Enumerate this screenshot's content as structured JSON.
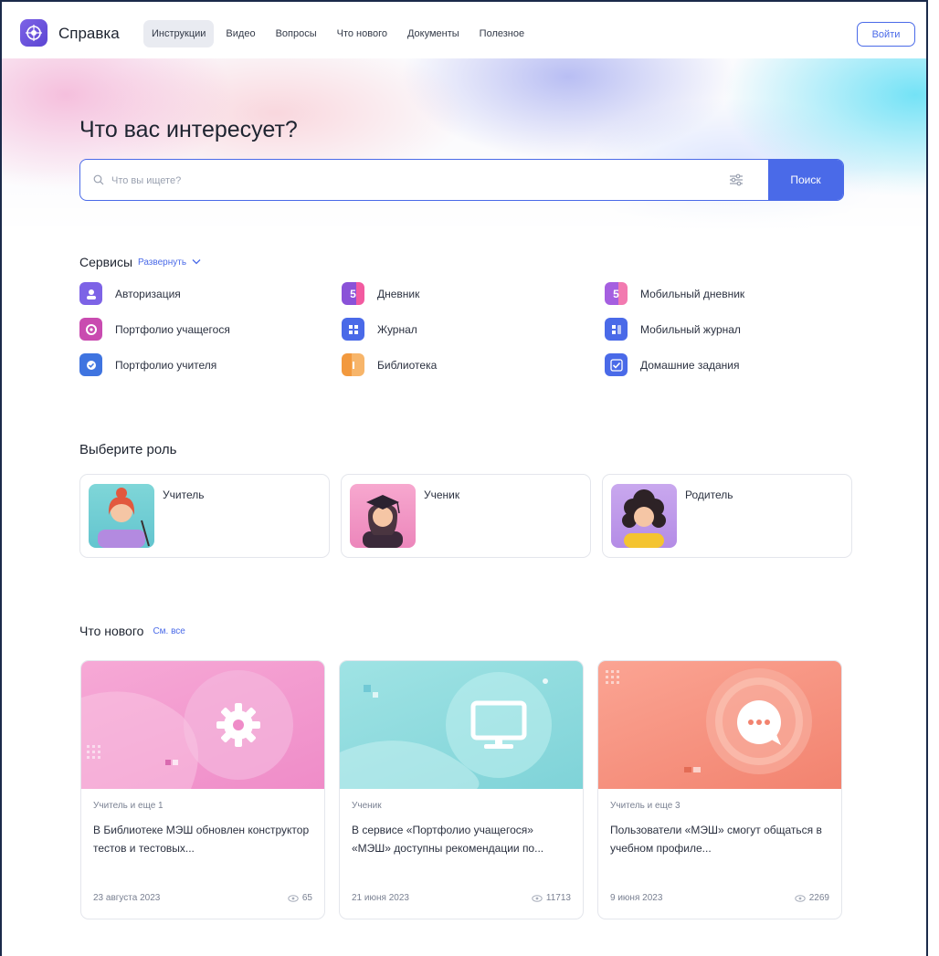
{
  "header": {
    "title": "Справка",
    "nav": [
      "Инструкции",
      "Видео",
      "Вопросы",
      "Что нового",
      "Документы",
      "Полезное"
    ],
    "active_nav": "Инструкции",
    "login_label": "Войти"
  },
  "hero": {
    "title": "Что вас интересует?",
    "search_placeholder": "Что вы ищете?",
    "search_value": "",
    "search_button": "Поиск"
  },
  "services": {
    "title": "Сервисы",
    "expand_label": "Развернуть",
    "items": [
      {
        "label": "Авторизация",
        "icon": "user-lock-icon",
        "color": "#7d63e6"
      },
      {
        "label": "Дневник",
        "icon": "diary-5-icon",
        "color": "#8a52d8"
      },
      {
        "label": "Мобильный дневник",
        "icon": "mobile-diary-icon",
        "color": "#a55fe0"
      },
      {
        "label": "Портфолио учащегося",
        "icon": "student-portfolio-icon",
        "color": "#c94bb0"
      },
      {
        "label": "Журнал",
        "icon": "journal-icon",
        "color": "#4a6ae8"
      },
      {
        "label": "Мобильный журнал",
        "icon": "mobile-journal-icon",
        "color": "#4a6ae8"
      },
      {
        "label": "Портфолио учителя",
        "icon": "teacher-portfolio-icon",
        "color": "#3f74e0"
      },
      {
        "label": "Библиотека",
        "icon": "library-icon",
        "color": "#f2993e"
      },
      {
        "label": "Домашние задания",
        "icon": "homework-check-icon",
        "color": "#4a6ae8"
      }
    ]
  },
  "roles": {
    "title": "Выберите роль",
    "items": [
      {
        "label": "Учитель"
      },
      {
        "label": "Ученик"
      },
      {
        "label": "Родитель"
      }
    ]
  },
  "news": {
    "title": "Что нового",
    "see_all": "См. все",
    "items": [
      {
        "category": "Учитель и еще 1",
        "title": "В Библиотеке МЭШ обновлен конструктор тестов и тестовых...",
        "date": "23 августа 2023",
        "views": "65",
        "icon": "gear-icon"
      },
      {
        "category": "Ученик",
        "title": "В сервисе «Портфолио учащегося» «МЭШ» доступны рекомендации по...",
        "date": "21 июня 2023",
        "views": "11713",
        "icon": "monitor-icon"
      },
      {
        "category": "Учитель и еще 3",
        "title": "Пользователи «МЭШ» смогут общаться в учебном профиле...",
        "date": "9 июня 2023",
        "views": "2269",
        "icon": "chat-bubble-icon"
      }
    ]
  }
}
